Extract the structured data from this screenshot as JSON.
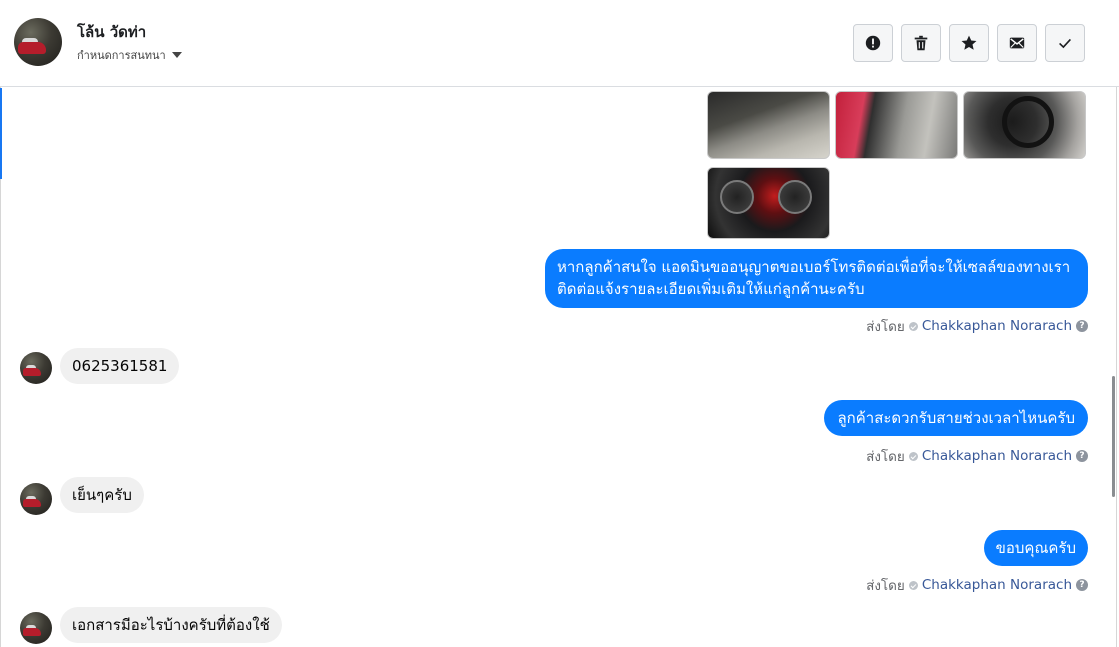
{
  "header": {
    "name": "โล้น วัดท่า",
    "subtitle": "กำหนดการสนทนา",
    "buttons": [
      {
        "icon": "alert-icon",
        "label": ""
      },
      {
        "icon": "trash-icon",
        "label": ""
      },
      {
        "icon": "star-icon",
        "label": ""
      },
      {
        "icon": "envelope-icon",
        "label": ""
      },
      {
        "icon": "checkmark-icon",
        "label": ""
      }
    ]
  },
  "colors": {
    "outgoing_bubble": "#0a7cff",
    "incoming_bubble": "#f0f0f0",
    "agent_name": "#385898",
    "accent": "#1877f2"
  },
  "messages": {
    "out1": {
      "line1": "หากลูกค้าสนใจ แอดมินขออนุญาตขอเบอร์โทรติดต่อเพื่อที่จะให้เซลล์ของทางเรา",
      "line2": "ติดต่อแจ้งรายละเอียดเพิ่มเติมให้แก่ลูกค้านะครับ",
      "sent_by_label": "ส่งโดย",
      "agent": "Chakkaphan Norarach"
    },
    "in1": {
      "text": "0625361581"
    },
    "out2": {
      "text": "ลูกค้าสะดวกรับสายช่วงเวลาไหนครับ",
      "sent_by_label": "ส่งโดย",
      "agent": "Chakkaphan Norarach"
    },
    "in2": {
      "text": "เย็นๆครับ"
    },
    "out3": {
      "text": "ขอบคุณครับ",
      "sent_by_label": "ส่งโดย",
      "agent": "Chakkaphan Norarach"
    },
    "in3": {
      "text": "เอกสารมีอะไรบ้างครับที่ต้องใช้"
    }
  }
}
